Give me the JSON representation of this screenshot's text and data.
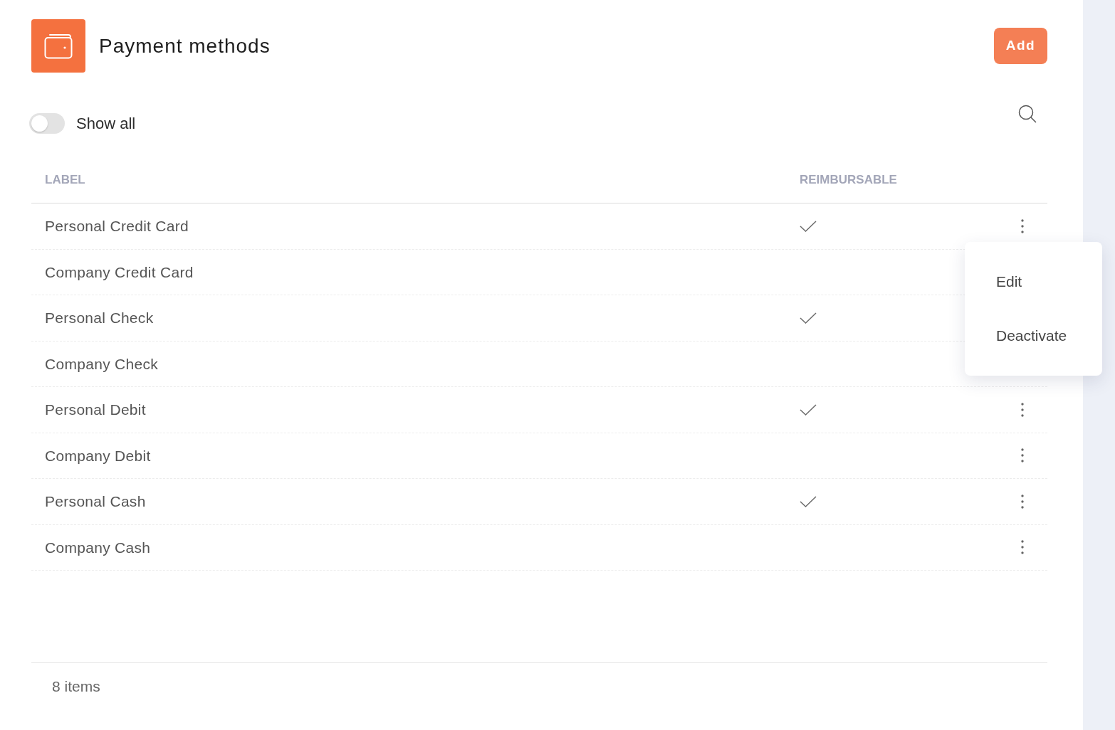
{
  "header": {
    "title": "Payment methods",
    "add_button": "Add"
  },
  "show_all": {
    "label": "Show all",
    "on": false
  },
  "table": {
    "columns": [
      "LABEL",
      "REIMBURSABLE"
    ],
    "rows": [
      {
        "label": "Personal Credit Card",
        "reimbursable": true,
        "menu_button": true
      },
      {
        "label": "Company Credit Card",
        "reimbursable": false,
        "menu_button": false
      },
      {
        "label": "Personal Check",
        "reimbursable": true,
        "menu_button": false
      },
      {
        "label": "Company Check",
        "reimbursable": false,
        "menu_button": false
      },
      {
        "label": "Personal Debit",
        "reimbursable": true,
        "menu_button": true
      },
      {
        "label": "Company Debit",
        "reimbursable": false,
        "menu_button": true
      },
      {
        "label": "Personal Cash",
        "reimbursable": true,
        "menu_button": true
      },
      {
        "label": "Company Cash",
        "reimbursable": false,
        "menu_button": true
      }
    ]
  },
  "row_menu": {
    "open": true,
    "items": [
      "Edit",
      "Deactivate"
    ]
  },
  "footer": {
    "count": "8 items"
  }
}
